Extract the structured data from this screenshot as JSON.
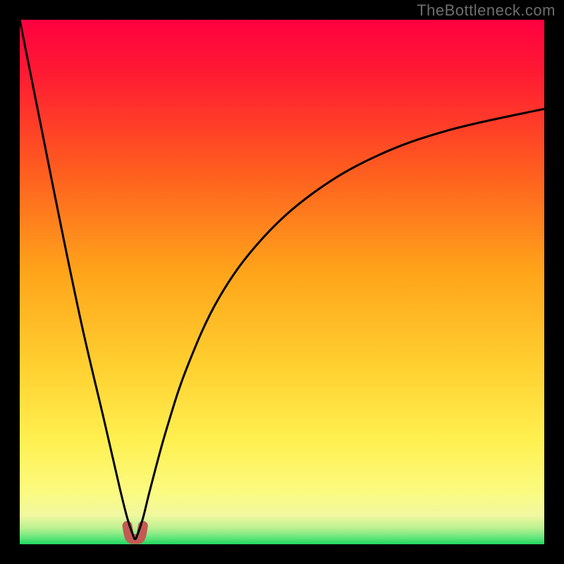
{
  "watermark": "TheBottleneck.com",
  "chart_data": {
    "type": "line",
    "title": "",
    "xlabel": "",
    "ylabel": "",
    "xlim": [
      0,
      1
    ],
    "ylim": [
      0,
      1
    ],
    "minimum_x": 0.22,
    "series": [
      {
        "name": "bottleneck-curve",
        "x": [
          0.0,
          0.04,
          0.08,
          0.12,
          0.16,
          0.19,
          0.205,
          0.215,
          0.22,
          0.225,
          0.235,
          0.25,
          0.28,
          0.32,
          0.38,
          0.46,
          0.56,
          0.68,
          0.82,
          1.0
        ],
        "y": [
          1.0,
          0.8,
          0.6,
          0.41,
          0.24,
          0.11,
          0.05,
          0.02,
          0.01,
          0.02,
          0.05,
          0.11,
          0.22,
          0.34,
          0.47,
          0.58,
          0.67,
          0.74,
          0.79,
          0.83
        ]
      },
      {
        "name": "minimum-marker",
        "x": [
          0.205,
          0.21,
          0.22,
          0.23,
          0.235
        ],
        "y": [
          0.035,
          0.013,
          0.01,
          0.013,
          0.035
        ]
      }
    ],
    "gradient_stops": [
      {
        "offset": 0.0,
        "color": "#ff0040"
      },
      {
        "offset": 0.1,
        "color": "#ff1a33"
      },
      {
        "offset": 0.28,
        "color": "#ff5a20"
      },
      {
        "offset": 0.48,
        "color": "#ffa41a"
      },
      {
        "offset": 0.66,
        "color": "#ffd030"
      },
      {
        "offset": 0.8,
        "color": "#fff050"
      },
      {
        "offset": 0.9,
        "color": "#fbfb80"
      },
      {
        "offset": 0.945,
        "color": "#f0f8a0"
      },
      {
        "offset": 0.97,
        "color": "#b8f090"
      },
      {
        "offset": 0.985,
        "color": "#70e880"
      },
      {
        "offset": 1.0,
        "color": "#20d860"
      }
    ],
    "curve_color": "#000000",
    "curve_width": 3,
    "marker_color": "#c25a54",
    "marker_width": 14
  }
}
